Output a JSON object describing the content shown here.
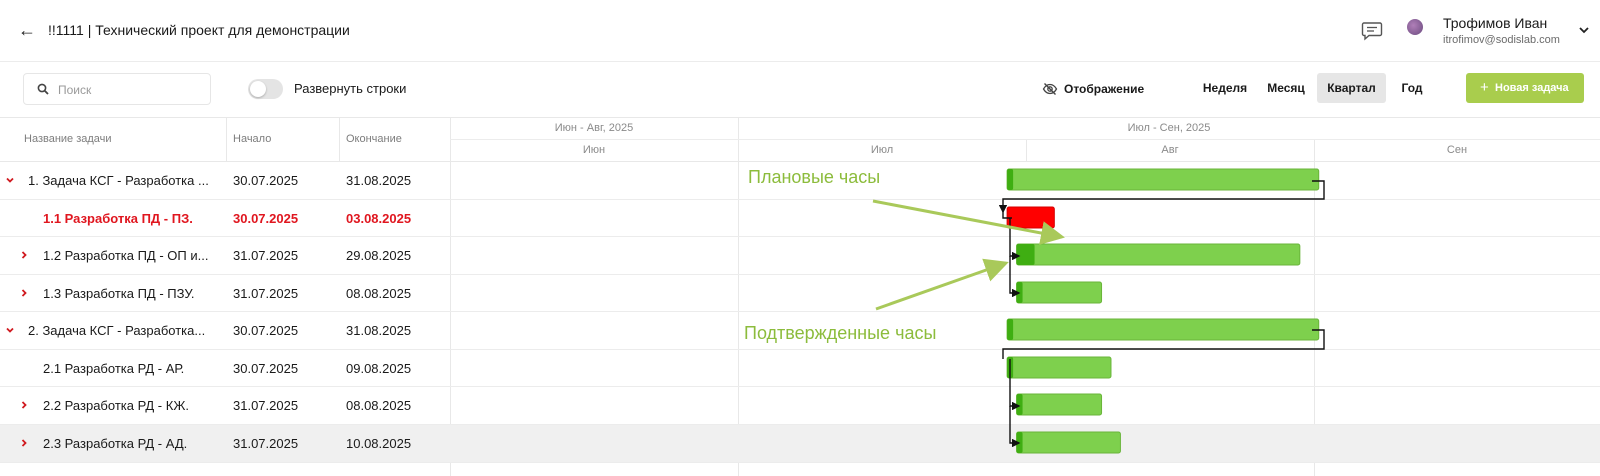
{
  "header": {
    "back_glyph": "←",
    "title": "!!1111 | Технический проект для демонстрации",
    "user_name": "Трофимов Иван",
    "user_email": "itrofimov@sodislab.com",
    "icons": [
      "back-arrow-icon",
      "chat-icon",
      "avatar",
      "chevron-down-icon"
    ]
  },
  "toolbar": {
    "search_placeholder": "Поиск",
    "expand_rows_label": "Развернуть строки",
    "expand_rows_on": false,
    "display_label": "Отображение",
    "periods": [
      {
        "label": "Неделя",
        "active": false
      },
      {
        "label": "Месяц",
        "active": false
      },
      {
        "label": "Квартал",
        "active": true
      },
      {
        "label": "Год",
        "active": false
      }
    ],
    "new_task_label": "Новая задача",
    "new_task_glyph": "+"
  },
  "columns": {
    "name": "Название задачи",
    "start": "Начало",
    "end": "Окончание"
  },
  "timeline": {
    "groups": [
      "Июн - Авг, 2025",
      "Июл - Сен, 2025"
    ],
    "months": [
      "Июн",
      "Июл",
      "Авг",
      "Сен"
    ]
  },
  "tasks": [
    {
      "name": "1. Задача КСГ - Разработка ...",
      "start": "30.07.2025",
      "end": "31.08.2025",
      "level": 0,
      "expanded": true,
      "status": "normal"
    },
    {
      "name": "1.1 Разработка ПД - ПЗ.",
      "start": "30.07.2025",
      "end": "03.08.2025",
      "level": 1,
      "expander": false,
      "status": "overdue"
    },
    {
      "name": "1.2 Разработка ПД - ОП и...",
      "start": "31.07.2025",
      "end": "29.08.2025",
      "level": 1,
      "expander": true,
      "status": "normal"
    },
    {
      "name": "1.3 Разработка ПД - ПЗУ.",
      "start": "31.07.2025",
      "end": "08.08.2025",
      "level": 1,
      "expander": true,
      "status": "normal"
    },
    {
      "name": "2. Задача КСГ - Разработка...",
      "start": "30.07.2025",
      "end": "31.08.2025",
      "level": 0,
      "expanded": true,
      "status": "normal"
    },
    {
      "name": "2.1 Разработка РД - АР.",
      "start": "30.07.2025",
      "end": "09.08.2025",
      "level": 1,
      "expander": false,
      "status": "normal"
    },
    {
      "name": "2.2 Разработка РД - КЖ.",
      "start": "31.07.2025",
      "end": "08.08.2025",
      "level": 1,
      "expander": true,
      "status": "normal"
    },
    {
      "name": "2.3 Разработка РД - АД.",
      "start": "31.07.2025",
      "end": "10.08.2025",
      "level": 1,
      "expander": true,
      "status": "normal",
      "highlighted": true
    }
  ],
  "annotations": {
    "planned_hours": "Плановые часы",
    "confirmed_hours": "Подтвержденные часы"
  },
  "colors": {
    "bar_fill": "#7ed04d",
    "bar_confirmed": "#3fae12",
    "bar_overdue": "#ff0000",
    "accent_green": "#a9cd4d",
    "annotation": "#8cbc3c",
    "overdue_text": "#e0161f",
    "chevron": "#d0191f"
  }
}
